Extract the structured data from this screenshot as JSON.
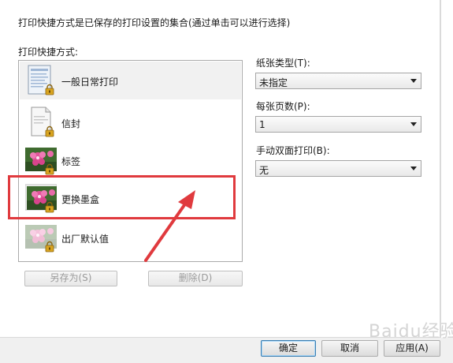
{
  "dialog": {
    "description": "打印快捷方式是已保存的打印设置的集合(通过单击可以进行选择)",
    "list_label": "打印快捷方式:",
    "shortcuts": [
      {
        "label": "一般日常打印",
        "icon": "document-thumbnail-icon",
        "selected": true
      },
      {
        "label": "信封",
        "icon": "envelope-thumbnail-icon",
        "selected": false
      },
      {
        "label": "标签",
        "icon": "flower-photo-thumbnail-icon",
        "selected": false
      },
      {
        "label": "更换墨盒",
        "icon": "flower-photo-thumbnail-icon",
        "selected": false
      },
      {
        "label": "出厂默认值",
        "icon": "faded-photo-thumbnail-icon",
        "selected": false
      }
    ],
    "save_as_label": "另存为(S)",
    "delete_label": "删除(D)"
  },
  "settings": {
    "paper_type_label": "纸张类型(T):",
    "paper_type_value": "未指定",
    "pages_per_sheet_label": "每张页数(P):",
    "pages_per_sheet_value": "1",
    "duplex_label": "手动双面打印(B):",
    "duplex_value": "无"
  },
  "footer": {
    "ok_label": "确定",
    "cancel_label": "取消",
    "apply_label": "应用(A)"
  },
  "annotation": {
    "highlight_color": "#e03a3e"
  },
  "watermark": "Baidu经验"
}
